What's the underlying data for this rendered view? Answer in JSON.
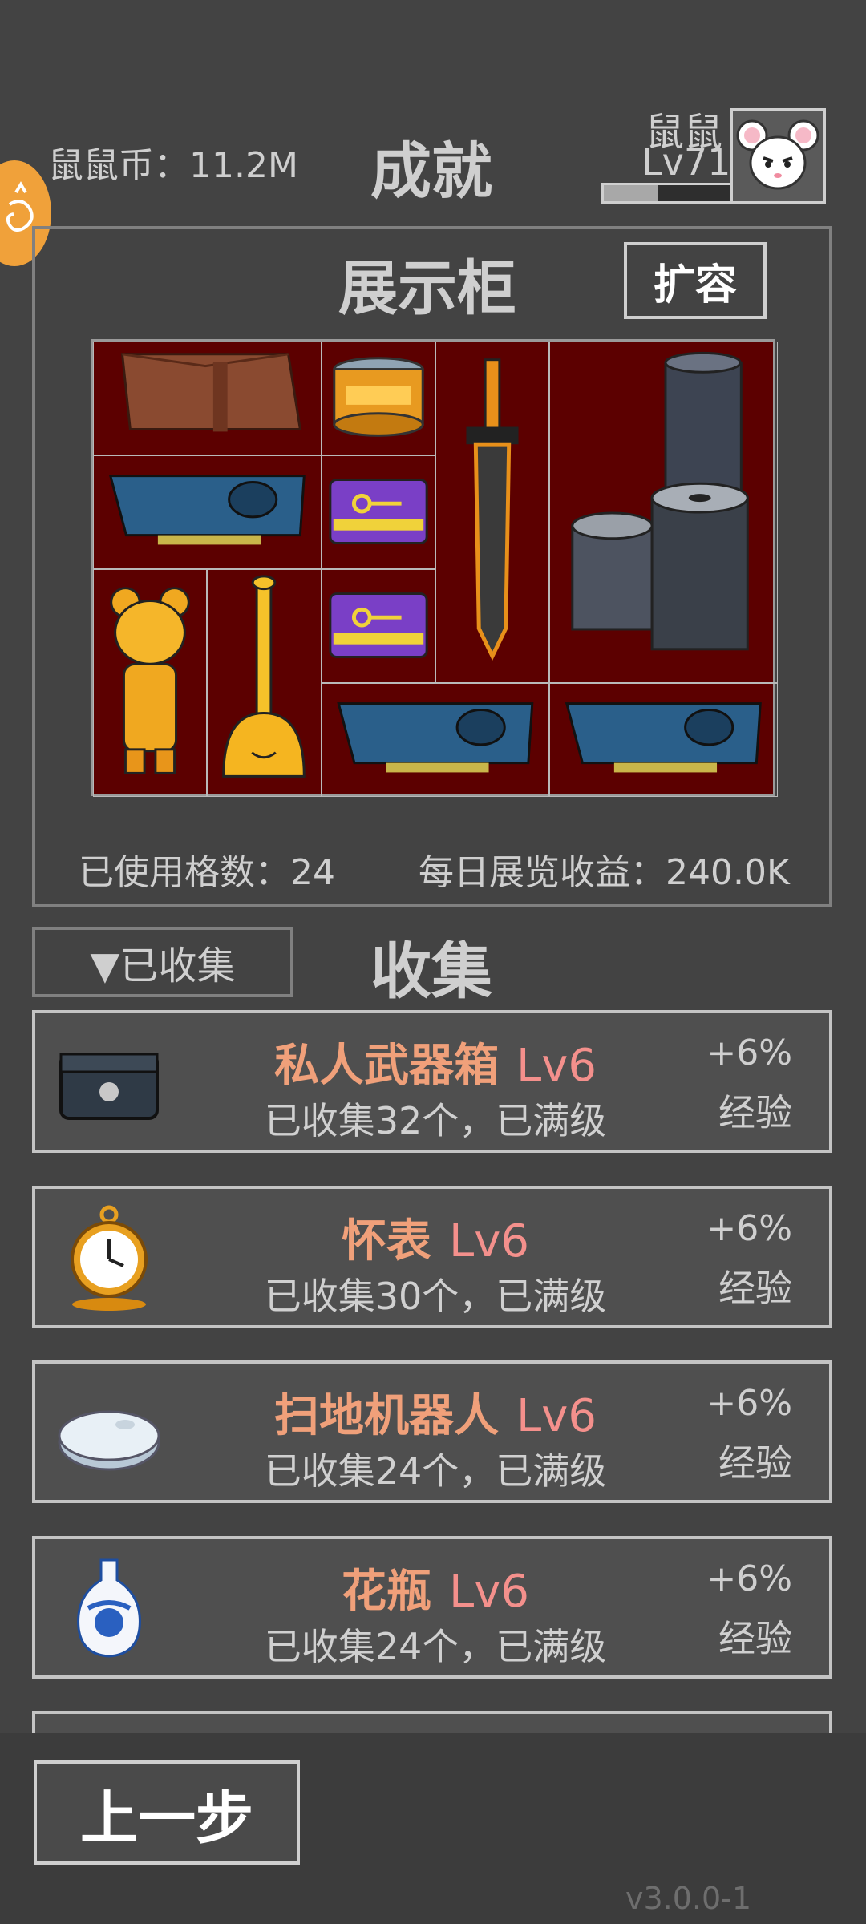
{
  "header": {
    "coins": "鼠鼠币：11.2M",
    "title": "成就",
    "player_name": "鼠鼠",
    "player_level": "Lv71",
    "xp_progress": 0.42
  },
  "showcase": {
    "title": "展示柜",
    "expand_label": "扩容",
    "used_cells": "已使用格数：24",
    "daily_income": "每日展览收益：240.0K",
    "items": [
      "leather-wallet-icon",
      "gold-can-icon",
      "sword-icon",
      "metal-cylinders-icon",
      "graphics-card-icon",
      "keycard-icon",
      "gold-bear-icon",
      "gold-plunger-icon",
      "keycard-icon",
      "graphics-card-icon",
      "graphics-card-icon"
    ]
  },
  "collection": {
    "filter_label": "▼已收集",
    "title": "收集",
    "items": [
      {
        "name": "私人武器箱",
        "level": "Lv6",
        "status": "已收集32个，已满级",
        "bonus": "+6%",
        "bonus_type": "经验",
        "icon": "weapon-case-icon"
      },
      {
        "name": "怀表",
        "level": "Lv6",
        "status": "已收集30个，已满级",
        "bonus": "+6%",
        "bonus_type": "经验",
        "icon": "pocket-watch-icon"
      },
      {
        "name": "扫地机器人",
        "level": "Lv6",
        "status": "已收集24个，已满级",
        "bonus": "+6%",
        "bonus_type": "经验",
        "icon": "robot-vacuum-icon"
      },
      {
        "name": "花瓶",
        "level": "Lv6",
        "status": "已收集24个，已满级",
        "bonus": "+6%",
        "bonus_type": "经验",
        "icon": "vase-icon"
      }
    ]
  },
  "footer": {
    "back_label": "上一步",
    "version": "v3.0.0-1"
  }
}
